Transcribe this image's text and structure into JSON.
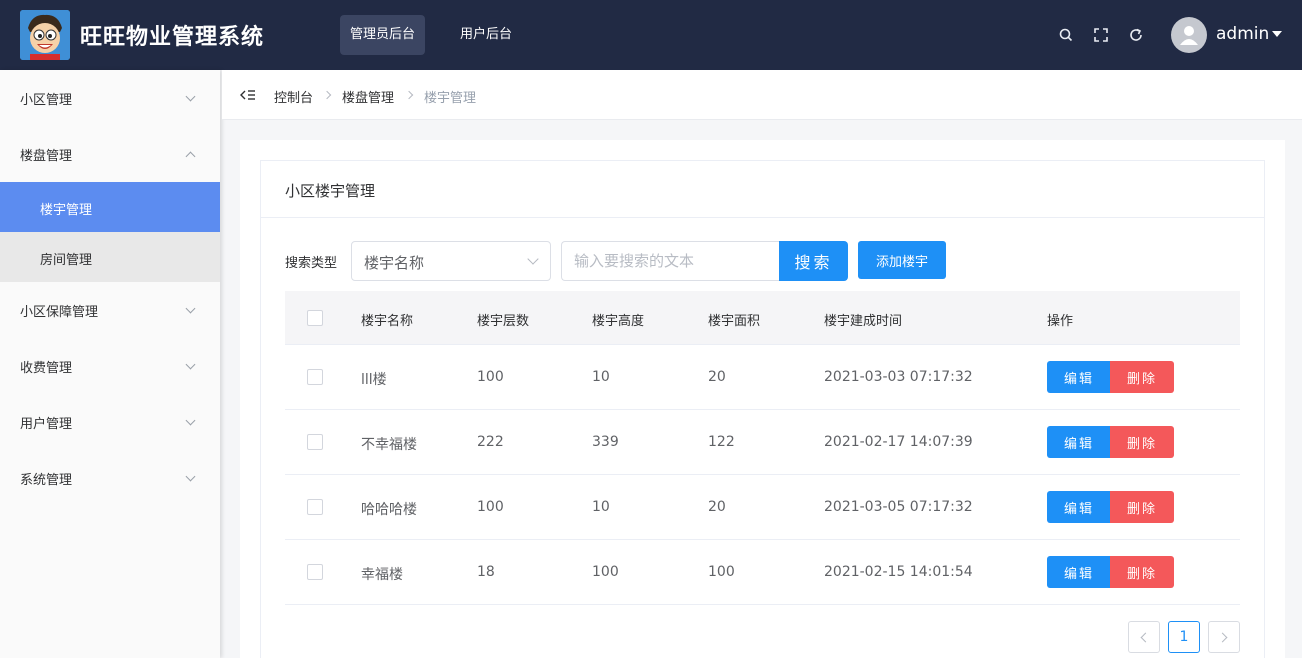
{
  "header": {
    "app_title": "旺旺物业管理系统",
    "nav": [
      "管理员后台",
      "用户后台"
    ],
    "active_nav": 0,
    "icons": [
      "search-icon",
      "fullscreen-icon",
      "refresh-icon"
    ],
    "user_name": "admin"
  },
  "sidebar": {
    "items": [
      {
        "label": "小区管理",
        "expanded": false
      },
      {
        "label": "楼盘管理",
        "expanded": true,
        "children": [
          {
            "label": "楼宇管理",
            "active": true
          },
          {
            "label": "房间管理",
            "active": false
          }
        ]
      },
      {
        "label": "小区保障管理",
        "expanded": false
      },
      {
        "label": "收费管理",
        "expanded": false
      },
      {
        "label": "用户管理",
        "expanded": false
      },
      {
        "label": "系统管理",
        "expanded": false
      }
    ]
  },
  "breadcrumb": [
    "控制台",
    "楼盘管理",
    "楼宇管理"
  ],
  "card": {
    "title": "小区楼宇管理"
  },
  "search": {
    "label": "搜索类型",
    "type_value": "楼宇名称",
    "placeholder": "输入要搜索的文本",
    "button": "搜索",
    "add_button": "添加楼宇"
  },
  "table": {
    "columns": [
      "楼宇名称",
      "楼宇层数",
      "楼宇高度",
      "楼宇面积",
      "楼宇建成时间",
      "操作"
    ],
    "rows": [
      {
        "name": "lll楼",
        "floors": "100",
        "height": "10",
        "area": "20",
        "built": "2021-03-03 07:17:32"
      },
      {
        "name": "不幸福楼",
        "floors": "222",
        "height": "339",
        "area": "122",
        "built": "2021-02-17 14:07:39"
      },
      {
        "name": "哈哈哈楼",
        "floors": "100",
        "height": "10",
        "area": "20",
        "built": "2021-03-05 07:17:32"
      },
      {
        "name": "幸福楼",
        "floors": "18",
        "height": "100",
        "area": "100",
        "built": "2021-02-15 14:01:54"
      }
    ],
    "edit_label": "编辑",
    "delete_label": "删除"
  },
  "pagination": {
    "current_page": "1"
  },
  "colors": {
    "header_bg": "#212a44",
    "primary": "#1e90f6",
    "danger": "#f4585a",
    "sidebar_active": "#5c8cf0"
  }
}
